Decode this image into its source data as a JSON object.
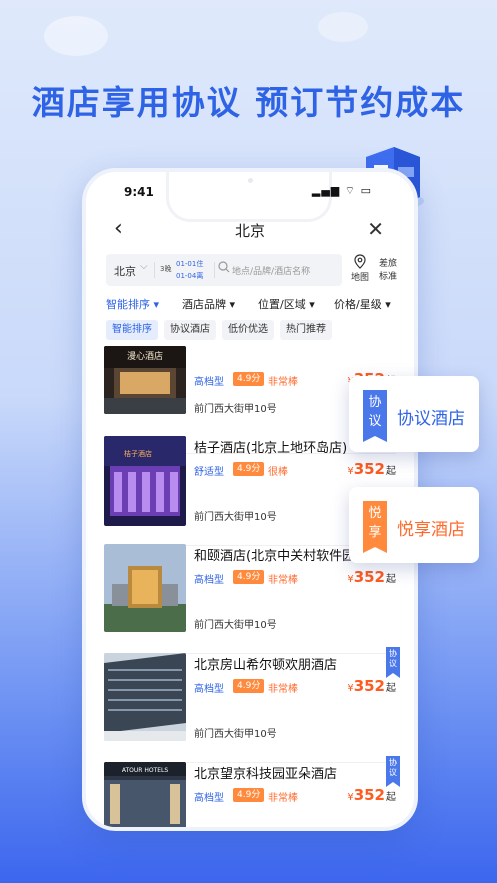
{
  "headline": "酒店享用协议  预订节约成本",
  "status": {
    "time": "9:41",
    "icons": "▂▄▆ ⌔ ▭"
  },
  "nav": {
    "title": "北京",
    "back": "‹",
    "close": "✕"
  },
  "search": {
    "city": "北京",
    "nights": "3晚",
    "checkin": "01-01住",
    "checkout": "01-04离",
    "placeholder": "地点/品牌/酒店名称"
  },
  "map_label": "地图",
  "travel_label_1": "差旅",
  "travel_label_2": "标准",
  "filters": [
    {
      "label": "智能排序 ▾"
    },
    {
      "label": "酒店品牌 ▾"
    },
    {
      "label": "位置/区域 ▾"
    },
    {
      "label": "价格/星级 ▾"
    }
  ],
  "tags": [
    "智能排序",
    "协议酒店",
    "低价优选",
    "热门推荐"
  ],
  "hotels": [
    {
      "name": "",
      "level": "高档型",
      "score": "4.9分",
      "comment": "非常棒",
      "price_prefix": "¥",
      "price": "352",
      "price_suffix": "起",
      "addr": "前门西大街甲10号",
      "ribbon": ""
    },
    {
      "name": "桔子酒店(北京上地环岛店)",
      "level": "舒适型",
      "score": "4.9分",
      "comment": "很棒",
      "price_prefix": "¥",
      "price": "352",
      "price_suffix": "起",
      "addr": "前门西大街甲10号",
      "ribbon": ""
    },
    {
      "name": "和颐酒店(北京中关村软件园",
      "level": "高档型",
      "score": "4.9分",
      "comment": "非常棒",
      "price_prefix": "¥",
      "price": "352",
      "price_suffix": "起",
      "addr": "前门西大街甲10号",
      "ribbon": ""
    },
    {
      "name": "北京房山希尔顿欢朋酒店",
      "level": "高档型",
      "score": "4.9分",
      "comment": "非常棒",
      "price_prefix": "¥",
      "price": "352",
      "price_suffix": "起",
      "addr": "前门西大街甲10号",
      "ribbon": "协议"
    },
    {
      "name": "北京望京科技园亚朵酒店",
      "level": "高档型",
      "score": "4.9分",
      "comment": "非常棒",
      "price_prefix": "¥",
      "price": "352",
      "price_suffix": "起",
      "addr": "",
      "ribbon": "协议"
    }
  ],
  "thumb_signs": [
    "漫心酒店",
    "桔子酒店",
    "",
    "",
    "ATOUR HOTELS"
  ],
  "float_cards": {
    "agreement": {
      "badge": "协议",
      "label": "协议酒店"
    },
    "yuexiang": {
      "badge": "悦享",
      "label": "悦享酒店"
    }
  },
  "colors": {
    "primary": "#2e63e6",
    "orange": "#ff8a3d",
    "price": "#ff5a1f"
  }
}
